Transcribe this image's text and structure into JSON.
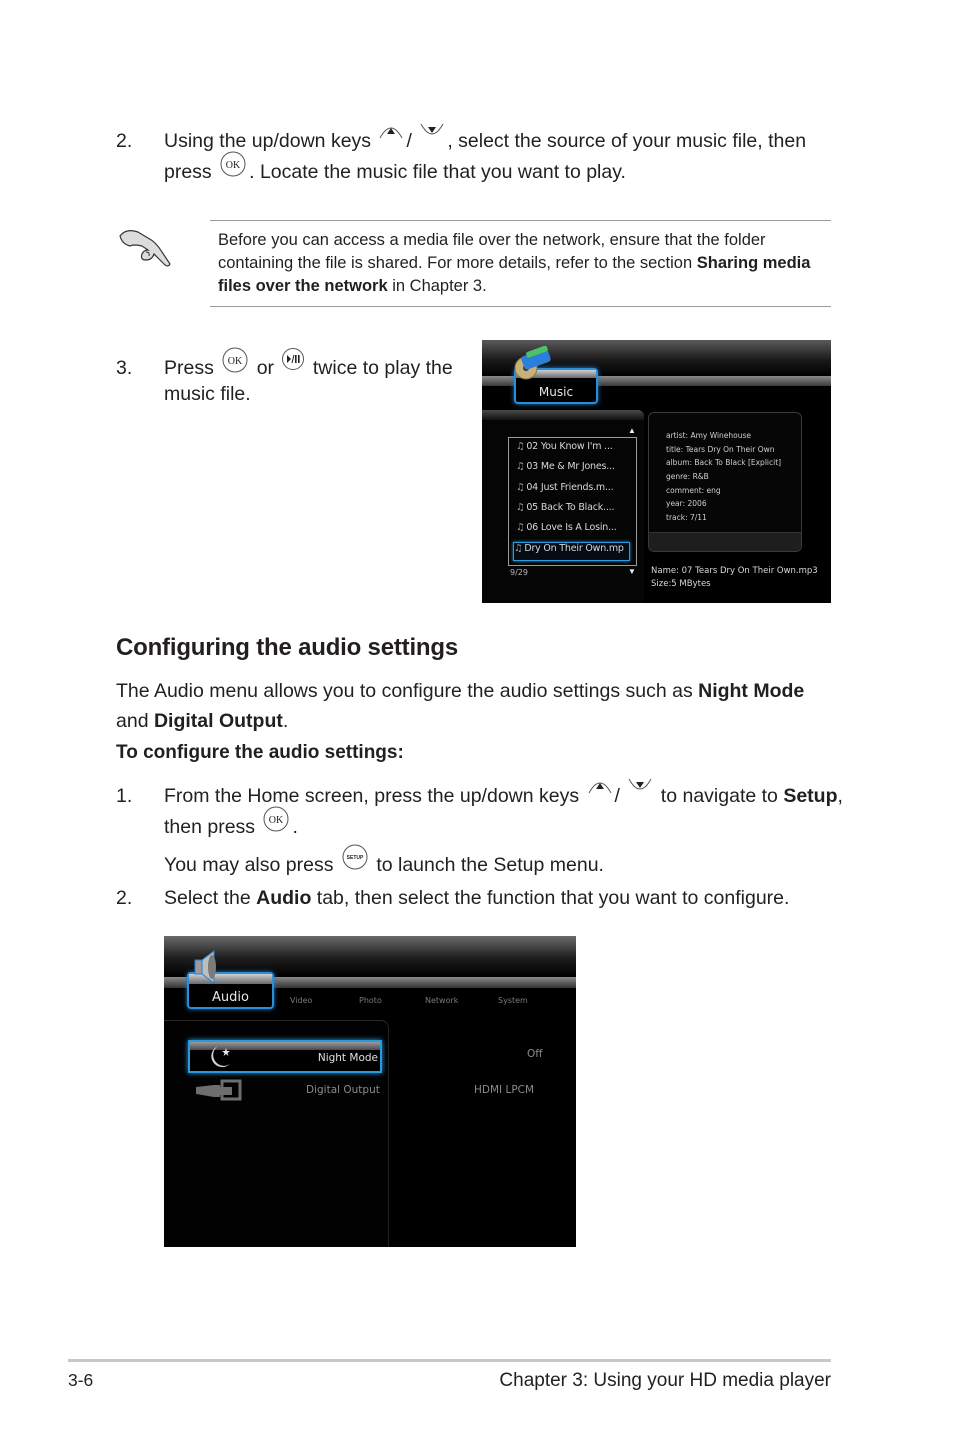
{
  "step2_music": {
    "number": "2.",
    "line1_a": "Using the up/down keys",
    "sep": "/",
    "line1_b": ", select the source of your music file, then",
    "line2_a": "press",
    "line2_b": ". Locate the music file that you want to play."
  },
  "note": {
    "icon": "pointing-hand-icon",
    "text_a": "Before you can access a media file over the network, ensure that the folder containing the file is shared. For more details, refer to the section ",
    "text_bold": "Sharing media files over the network",
    "text_b": " in Chapter 3."
  },
  "step3_music": {
    "number": "3.",
    "a": "Press",
    "b": "or",
    "c": "twice to play the",
    "d": "music file."
  },
  "music_screen": {
    "tab_label": "Music",
    "tracks": [
      {
        "label": "02 You Know I'm ...",
        "selected": false
      },
      {
        "label": "03 Me & Mr Jones...",
        "selected": false
      },
      {
        "label": "04 Just Friends.m...",
        "selected": false
      },
      {
        "label": "05 Back To Black....",
        "selected": false
      },
      {
        "label": "06 Love Is A Losin...",
        "selected": false
      },
      {
        "label": "Dry On Their Own.mp",
        "selected": true
      }
    ],
    "counter": "9/29",
    "scroll_up": "▲",
    "scroll_down": "▼",
    "metadata": [
      "artist: Amy Winehouse",
      "title: Tears Dry On Their Own",
      "album: Back To Black [Explicit]",
      "genre: R&B",
      "comment: eng",
      "year: 2006",
      "track: 7/11"
    ],
    "file_name": "Name: 07 Tears Dry On Their Own.mp3",
    "file_size": "Size:5 MBytes"
  },
  "section": {
    "heading": "Configuring the audio settings",
    "intro_a": "The Audio menu allows you to configure the audio settings such as ",
    "intro_bold1": "Night Mode",
    "intro_b": "and ",
    "intro_bold2": "Digital Output",
    "intro_c": ".",
    "subheading": "To configure the audio settings:"
  },
  "audio_steps": {
    "s1_number": "1.",
    "s1_a": "From the Home screen, press the up/down keys",
    "s1_sep": "/",
    "s1_b": "to navigate to ",
    "s1_bold": "Setup",
    "s1_c": ",",
    "s1_line2_a": "then press",
    "s1_line2_b": ".",
    "s1_also_a": "You may also press",
    "s1_also_b": "to launch the Setup menu.",
    "s2_number": "2.",
    "s2_a": "Select the ",
    "s2_bold": "Audio",
    "s2_b": " tab, then select the function that you want to configure."
  },
  "setup_screen": {
    "tabs": [
      "Audio",
      "Video",
      "Photo",
      "Network",
      "System"
    ],
    "active_tab": "Audio",
    "options": [
      {
        "label": "Night Mode",
        "value": "Off",
        "selected": true,
        "icon": "moon-star-icon"
      },
      {
        "label": "Digital Output",
        "value": "HDMI LPCM",
        "selected": false,
        "icon": "digital-output-icon"
      }
    ]
  },
  "button_icons": {
    "up": "up-key-icon",
    "down": "down-key-icon",
    "ok": "OK",
    "play_pause": "play-pause-icon",
    "setup": "SETUP"
  },
  "footer": {
    "page_number": "3-6",
    "chapter": "Chapter 3: Using your HD media player"
  }
}
